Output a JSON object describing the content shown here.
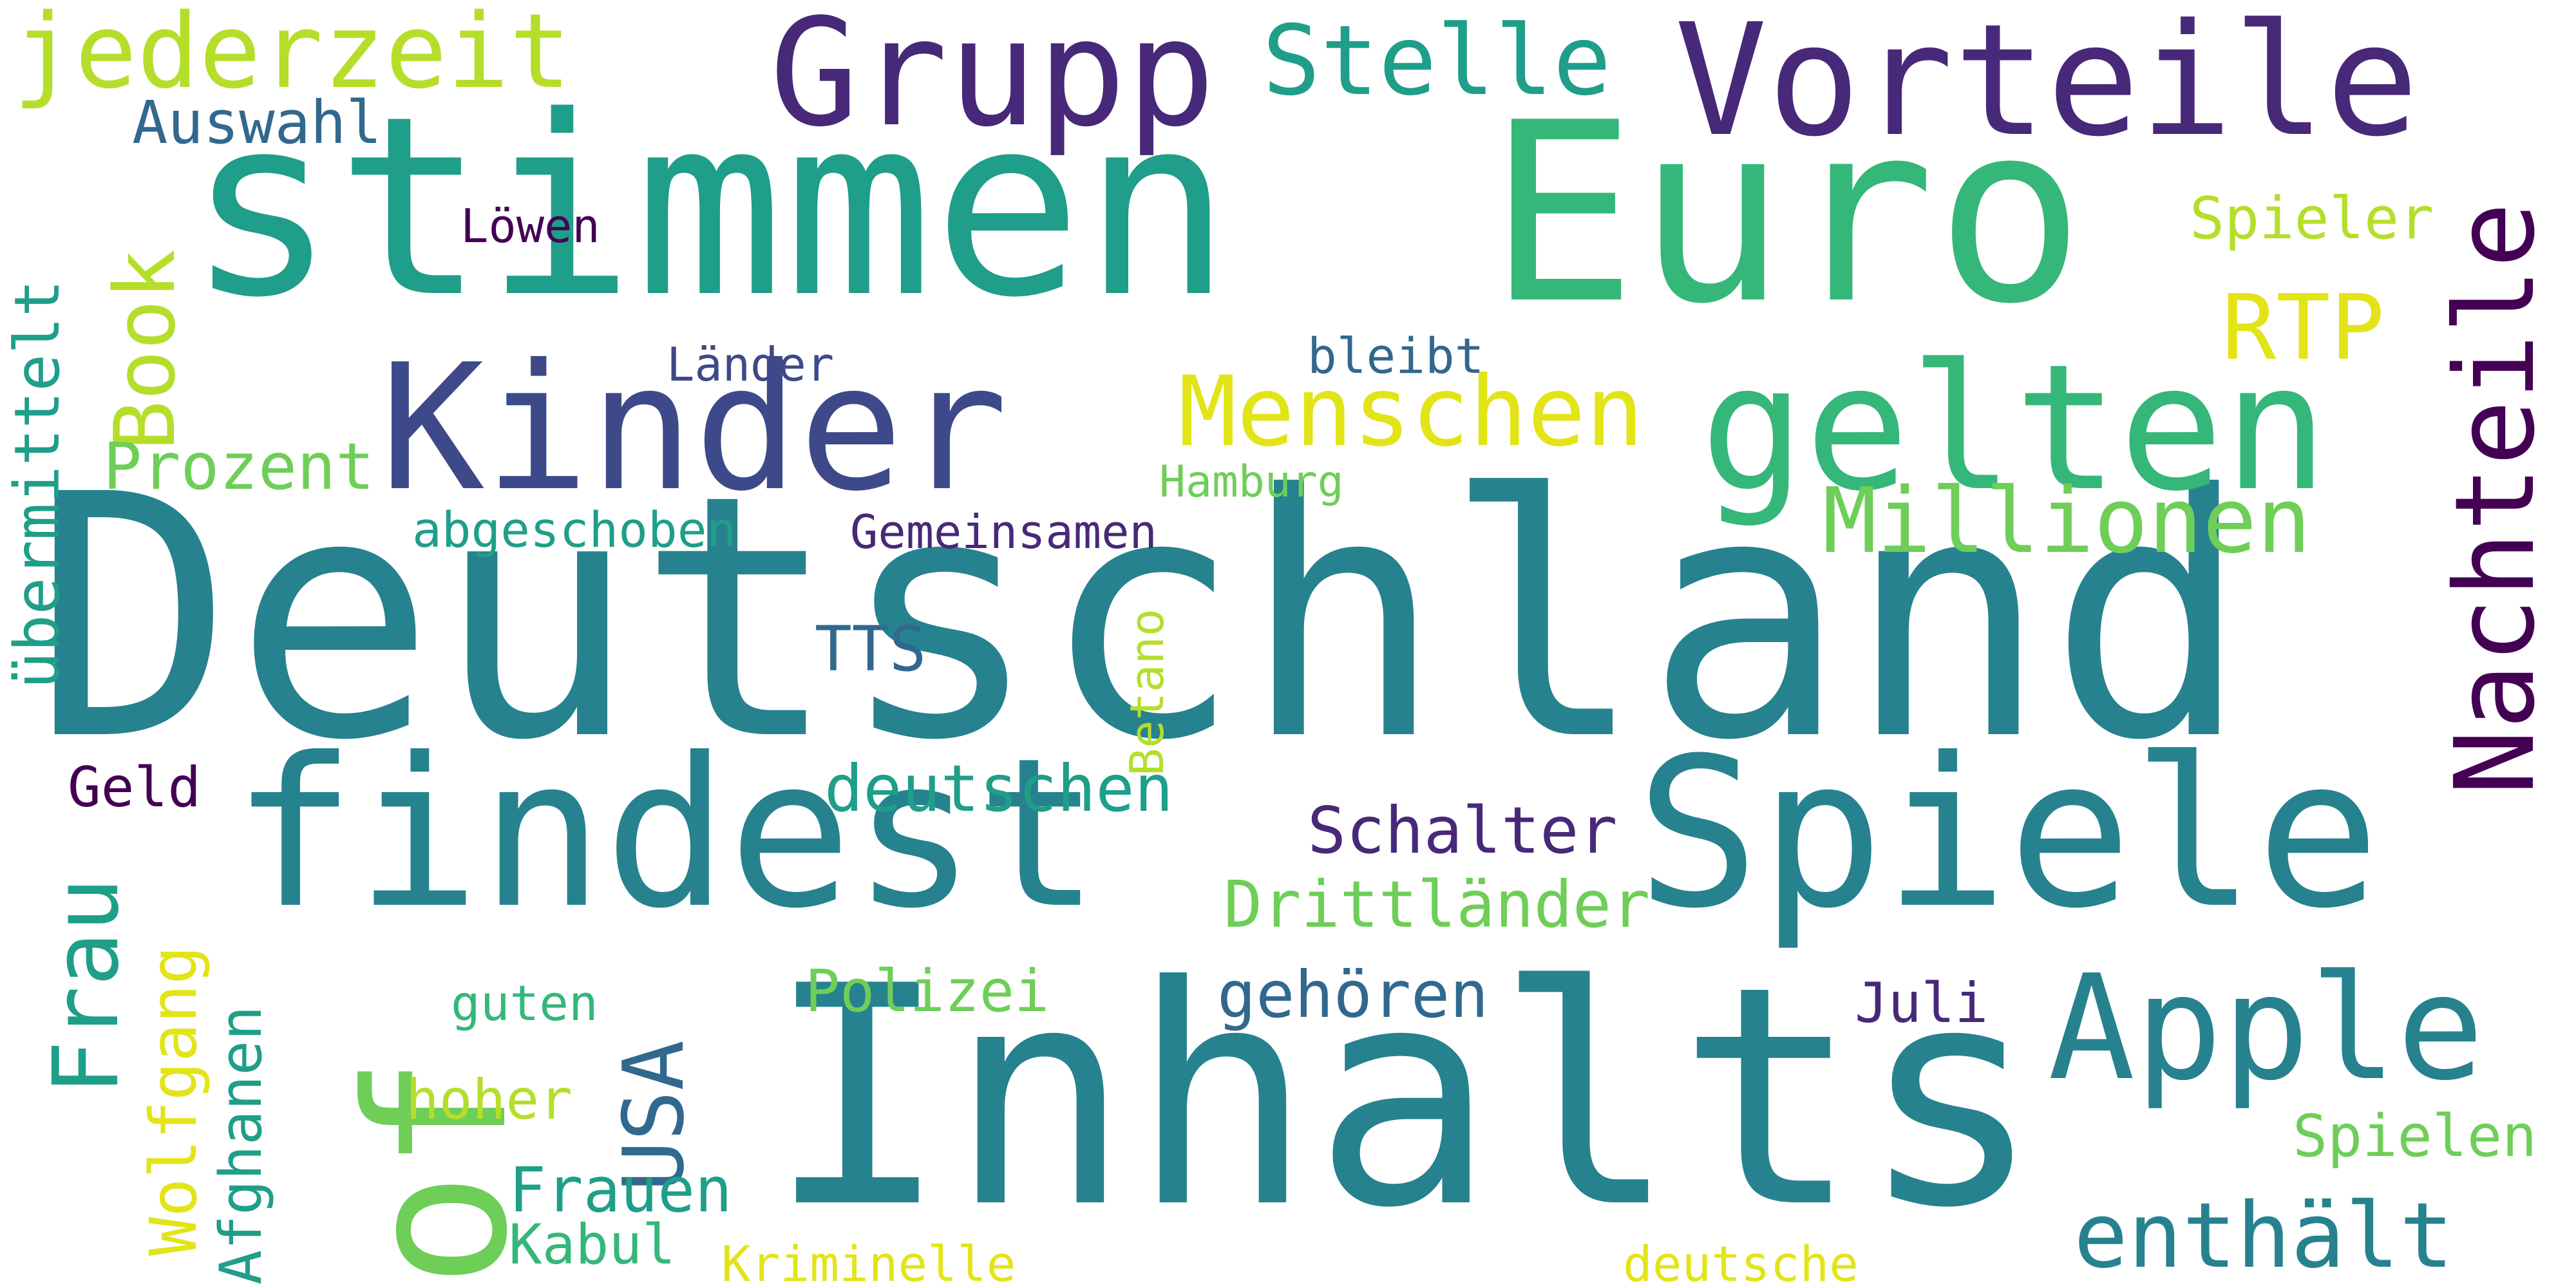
{
  "colors": {
    "background": "#ffffff",
    "yellow": "#e2e418",
    "lime": "#b5de2b",
    "light_green": "#6ece58",
    "green": "#35b779",
    "teal_green": "#1f9e89",
    "teal": "#26828e",
    "blue_teal": "#31688e",
    "indigo": "#3e4989",
    "purple": "#482878",
    "dark_purple": "#440154"
  },
  "words": {
    "deutschland": "Deutschland",
    "stimmen": "stimmen",
    "euro": "Euro",
    "inhalts": "Inhalts",
    "findest": "findest",
    "spiele": "Spiele",
    "kinder": "Kinder",
    "gelten": "gelten",
    "vorteile": "Vorteile",
    "grupp": "Grupp",
    "of": "of",
    "apple": "Apple",
    "nachteile": "Nachteile",
    "stelle": "Stelle",
    "jederzeit": "jederzeit",
    "menschen": "Menschen",
    "millionen": "Millionen",
    "enthaelt": "enthält",
    "book": "Book",
    "frau": "Frau",
    "usa": "USA",
    "rtp": "RTP",
    "uebermittelt": "übermittelt",
    "deutschen": "deutschen",
    "drittlaender": "Drittländer",
    "wolfgang": "Wolfgang",
    "prozent": "Prozent",
    "auswahl": "Auswahl",
    "schalter": "Schalter",
    "gehoeren": "gehören",
    "afghanen": "Afghanen",
    "frauen": "Frauen",
    "spieler": "Spieler",
    "spielen": "Spielen",
    "polizei": "Polizei",
    "hoher": "hoher",
    "abgeschoben": "abgeschoben",
    "gemeinsamen": "Gemeinsamen",
    "tts": "TTS",
    "kabul": "Kabul",
    "betano": "Betano",
    "geld": "Geld",
    "loewen": "Löwen",
    "laender": "Länder",
    "bleibt": "bleibt",
    "hamburg": "Hamburg",
    "guten": "guten",
    "juli": "Juli",
    "kriminelle": "Kriminelle",
    "deutsche": "deutsche"
  }
}
